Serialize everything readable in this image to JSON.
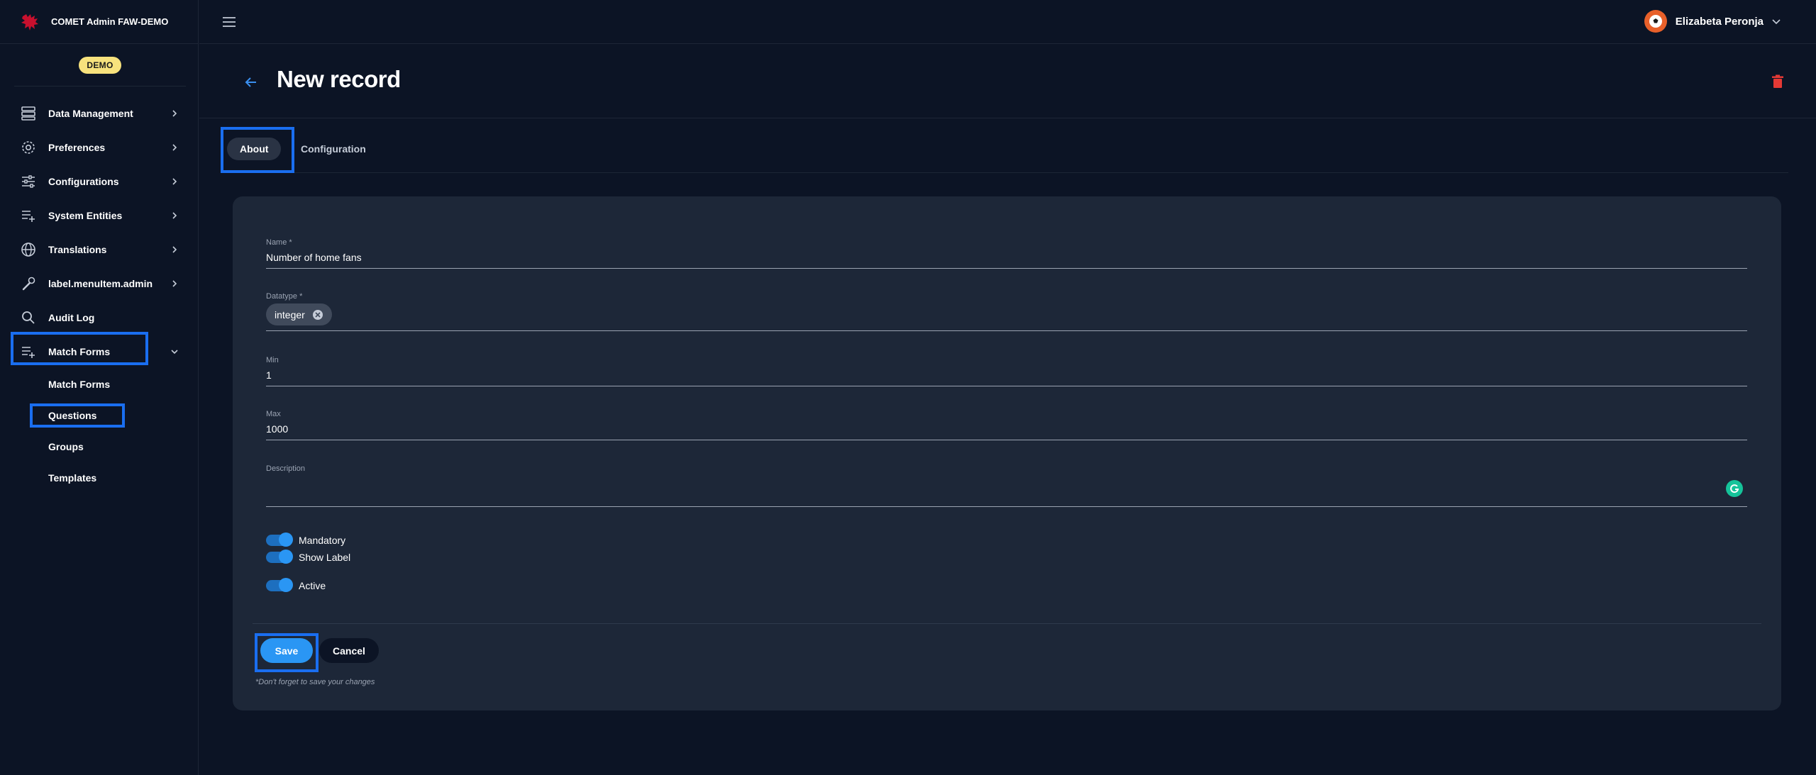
{
  "app": {
    "title": "COMET Admin FAW-DEMO",
    "env_badge": "DEMO",
    "brand_color": "#c8102e"
  },
  "sidebar": {
    "items": [
      {
        "label": "Data Management",
        "icon": "storage-icon"
      },
      {
        "label": "Preferences",
        "icon": "gear-icon"
      },
      {
        "label": "Configurations",
        "icon": "sliders-icon"
      },
      {
        "label": "System Entities",
        "icon": "playlist-add-icon"
      },
      {
        "label": "Translations",
        "icon": "globe-icon"
      },
      {
        "label": "label.menuItem.admin",
        "icon": "wrench-icon"
      },
      {
        "label": "Audit Log",
        "icon": "search-icon"
      },
      {
        "label": "Match Forms",
        "icon": "playlist-add-icon",
        "expanded": true
      }
    ],
    "subitems": [
      {
        "label": "Match Forms"
      },
      {
        "label": "Questions",
        "selected": true
      },
      {
        "label": "Groups"
      },
      {
        "label": "Templates"
      }
    ]
  },
  "topbar": {
    "user_name": "Elizabeta Peronja"
  },
  "header": {
    "title": "New record"
  },
  "tabs": [
    {
      "label": "About",
      "active": true
    },
    {
      "label": "Configuration",
      "active": false
    }
  ],
  "form": {
    "name": {
      "label": "Name *",
      "value": "Number of home fans"
    },
    "datatype": {
      "label": "Datatype *",
      "chip": "integer"
    },
    "min": {
      "label": "Min",
      "value": "1"
    },
    "max": {
      "label": "Max",
      "value": "1000"
    },
    "description": {
      "label": "Description",
      "value": ""
    },
    "toggles": [
      {
        "label": "Mandatory",
        "on": true
      },
      {
        "label": "Show Label",
        "on": true
      },
      {
        "label": "Active",
        "on": true
      }
    ],
    "save_label": "Save",
    "cancel_label": "Cancel",
    "save_note": "*Don't forget to save your changes"
  },
  "colors": {
    "background": "#0c1425",
    "card": "#1d2738",
    "accent": "#2a96f4",
    "highlight": "#1a6ef0",
    "danger": "#e53935"
  }
}
